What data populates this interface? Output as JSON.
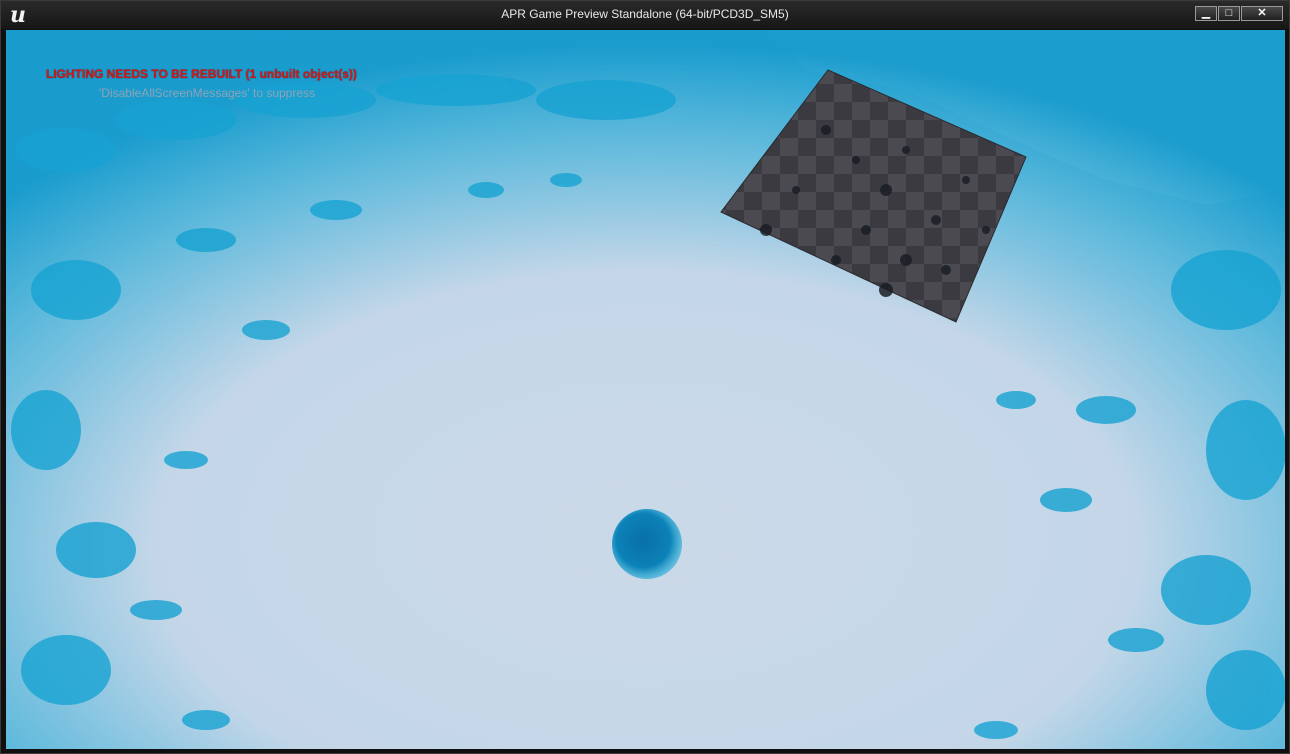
{
  "window": {
    "title": "APR Game Preview Standalone (64-bit/PCD3D_SM5)",
    "logo_text": "u",
    "buttons": {
      "minimize": "▁",
      "maximize": "□",
      "close": "✕"
    }
  },
  "hud": {
    "lighting_warning": "LIGHTING NEEDS TO BE REBUILT (1 unbuilt object(s))",
    "suppress_hint": "'DisableAllScreenMessages' to suppress"
  },
  "colors": {
    "fluid": "#1aa6d4",
    "fluid_deep": "#0b82b8",
    "background": "#c7d7e8",
    "warning": "#d21a1a"
  }
}
